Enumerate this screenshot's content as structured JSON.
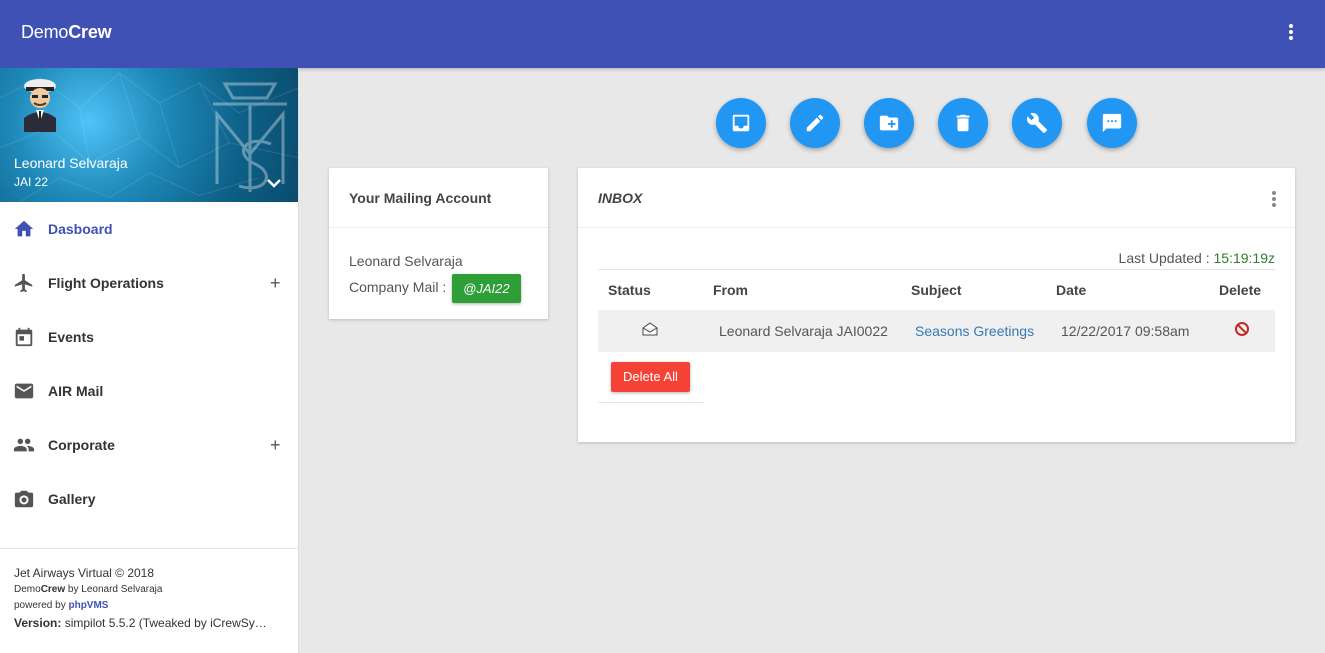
{
  "app": {
    "brand_light": "Demo",
    "brand_bold": "Crew",
    "menu_icon": "more-vert-icon"
  },
  "profile": {
    "name": "Leonard Selvaraja",
    "id": "JAI 22"
  },
  "sidebar": {
    "items": [
      {
        "label": "Dasboard",
        "icon": "home-icon",
        "expandable": false,
        "active": true
      },
      {
        "label": "Flight Operations",
        "icon": "airplane-icon",
        "expandable": true
      },
      {
        "label": "Events",
        "icon": "calendar-icon",
        "expandable": false
      },
      {
        "label": "AIR Mail",
        "icon": "mail-icon",
        "expandable": false
      },
      {
        "label": "Corporate",
        "icon": "people-icon",
        "expandable": true
      },
      {
        "label": "Gallery",
        "icon": "camera-icon",
        "expandable": false
      }
    ],
    "expand_symbol": "+"
  },
  "footer": {
    "copyright": "Jet Airways Virtual © 2018",
    "credit_prefix": "Demo",
    "credit_bold": "Crew",
    "credit_suffix": " by Leonard Selvaraja",
    "powered_prefix": "powered by ",
    "powered_link": "phpVMS",
    "version_label": "Version:",
    "version_value": " simpilot 5.5.2 (Tweaked by iCrewSy…"
  },
  "actions": [
    {
      "icon": "inbox-icon"
    },
    {
      "icon": "compose-icon"
    },
    {
      "icon": "new-folder-icon"
    },
    {
      "icon": "trash-icon"
    },
    {
      "icon": "settings-wrench-icon"
    },
    {
      "icon": "message-icon"
    }
  ],
  "account_card": {
    "title": "Your Mailing Account",
    "name": "Leonard Selvaraja",
    "company_label": "Company Mail :",
    "company_mail": "@JAI22"
  },
  "inbox": {
    "title": "INBOX",
    "last_updated_label": "Last Updated : ",
    "last_updated_time": "15:19:19z",
    "columns": [
      "Status",
      "From",
      "Subject",
      "Date",
      "Delete"
    ],
    "rows": [
      {
        "status_icon": "envelope-open-icon",
        "from": "Leonard Selvaraja JAI0022",
        "subject": "Seasons Greetings",
        "date": "12/22/2017 09:58am",
        "delete_icon": "no-entry-icon"
      }
    ],
    "delete_all": "Delete All"
  },
  "colors": {
    "primary": "#3f51b5",
    "fab": "#2196f3",
    "success": "#2e9e36",
    "danger": "#f44336",
    "link": "#337ab7"
  }
}
